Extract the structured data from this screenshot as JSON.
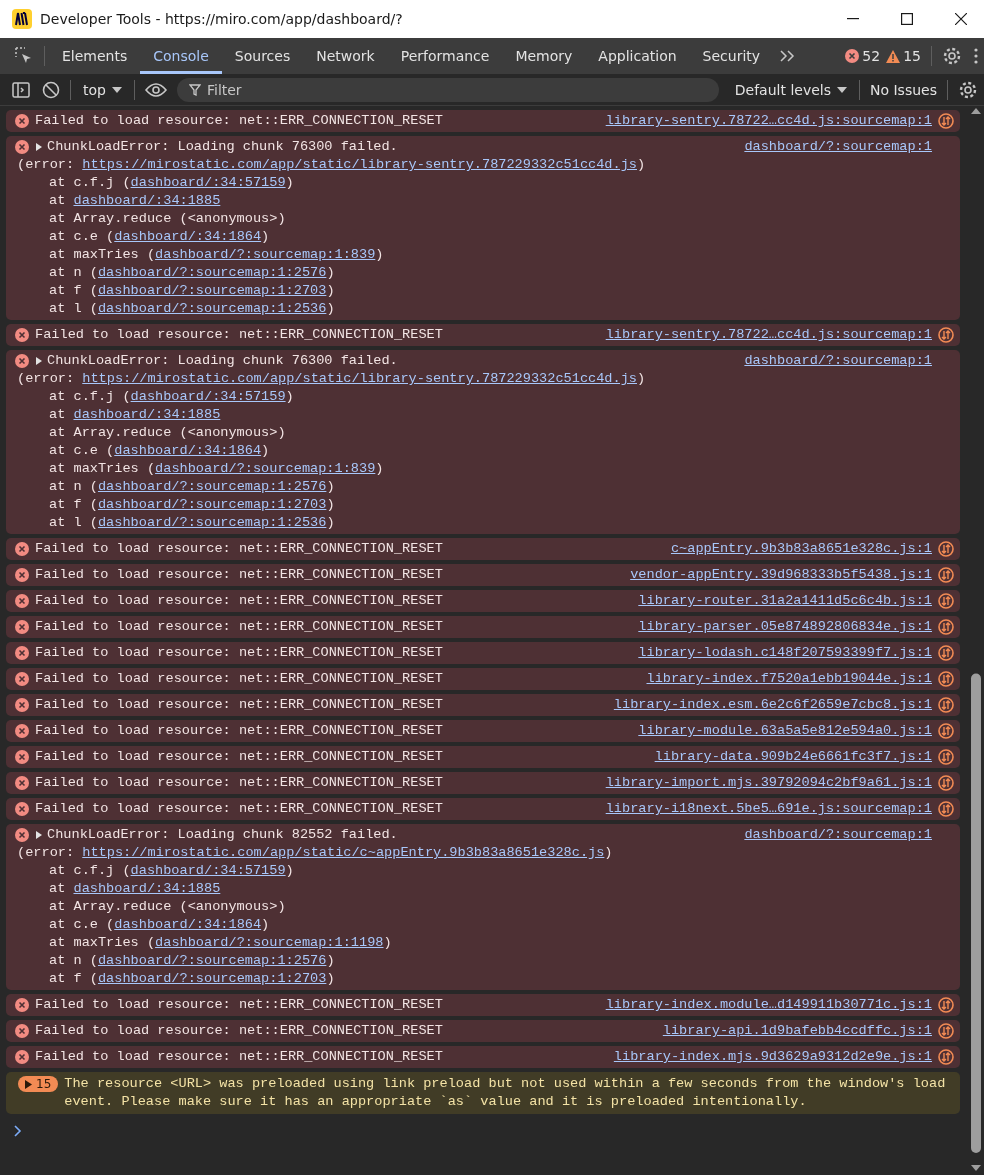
{
  "window": {
    "title": "Developer Tools - https://miro.com/app/dashboard/?"
  },
  "tabs": [
    {
      "label": "Elements",
      "selected": false
    },
    {
      "label": "Console",
      "selected": true
    },
    {
      "label": "Sources",
      "selected": false
    },
    {
      "label": "Network",
      "selected": false
    },
    {
      "label": "Performance",
      "selected": false
    },
    {
      "label": "Memory",
      "selected": false
    },
    {
      "label": "Application",
      "selected": false
    },
    {
      "label": "Security",
      "selected": false
    }
  ],
  "counts": {
    "errors": "52",
    "warnings": "15"
  },
  "toolbar": {
    "context": "top",
    "filter_placeholder": "Filter",
    "levels": "Default levels",
    "issues": "No Issues"
  },
  "messages": [
    {
      "kind": "resource",
      "text": "Failed to load resource: net::ERR_CONNECTION_RESET",
      "source": "library-sentry.78722…cc4d.js:sourcemap:1"
    },
    {
      "kind": "chunk",
      "text": "ChunkLoadError: Loading chunk 76300 failed.",
      "source": "dashboard/?:sourcemap:1",
      "lines": [
        {
          "kind": "error",
          "before": "(error: ",
          "link": "https://mirostatic.com/app/static/library-sentry.787229332c51cc4d.js",
          "after": ")"
        },
        {
          "kind": "frame",
          "before": "at c.f.j (",
          "link": "dashboard/:34:57159",
          "after": ")"
        },
        {
          "kind": "frame",
          "before": "at ",
          "link": "dashboard/:34:1885"
        },
        {
          "kind": "frame",
          "before": "at Array.reduce (<anonymous>)"
        },
        {
          "kind": "frame",
          "before": "at c.e (",
          "link": "dashboard/:34:1864",
          "after": ")"
        },
        {
          "kind": "frame",
          "before": "at maxTries (",
          "link": "dashboard/?:sourcemap:1:839",
          "after": ")"
        },
        {
          "kind": "frame",
          "before": "at n (",
          "link": "dashboard/?:sourcemap:1:2576",
          "after": ")"
        },
        {
          "kind": "frame",
          "before": "at f (",
          "link": "dashboard/?:sourcemap:1:2703",
          "after": ")"
        },
        {
          "kind": "frame",
          "before": "at l (",
          "link": "dashboard/?:sourcemap:1:2536",
          "after": ")"
        }
      ]
    },
    {
      "kind": "resource",
      "text": "Failed to load resource: net::ERR_CONNECTION_RESET",
      "source": "library-sentry.78722…cc4d.js:sourcemap:1"
    },
    {
      "kind": "chunk",
      "text": "ChunkLoadError: Loading chunk 76300 failed.",
      "source": "dashboard/?:sourcemap:1",
      "lines": [
        {
          "kind": "error",
          "before": "(error: ",
          "link": "https://mirostatic.com/app/static/library-sentry.787229332c51cc4d.js",
          "after": ")"
        },
        {
          "kind": "frame",
          "before": "at c.f.j (",
          "link": "dashboard/:34:57159",
          "after": ")"
        },
        {
          "kind": "frame",
          "before": "at ",
          "link": "dashboard/:34:1885"
        },
        {
          "kind": "frame",
          "before": "at Array.reduce (<anonymous>)"
        },
        {
          "kind": "frame",
          "before": "at c.e (",
          "link": "dashboard/:34:1864",
          "after": ")"
        },
        {
          "kind": "frame",
          "before": "at maxTries (",
          "link": "dashboard/?:sourcemap:1:839",
          "after": ")"
        },
        {
          "kind": "frame",
          "before": "at n (",
          "link": "dashboard/?:sourcemap:1:2576",
          "after": ")"
        },
        {
          "kind": "frame",
          "before": "at f (",
          "link": "dashboard/?:sourcemap:1:2703",
          "after": ")"
        },
        {
          "kind": "frame",
          "before": "at l (",
          "link": "dashboard/?:sourcemap:1:2536",
          "after": ")"
        }
      ]
    },
    {
      "kind": "resource",
      "text": "Failed to load resource: net::ERR_CONNECTION_RESET",
      "source": "c~appEntry.9b3b83a8651e328c.js:1"
    },
    {
      "kind": "resource",
      "text": "Failed to load resource: net::ERR_CONNECTION_RESET",
      "source": "vendor-appEntry.39d968333b5f5438.js:1"
    },
    {
      "kind": "resource",
      "text": "Failed to load resource: net::ERR_CONNECTION_RESET",
      "source": "library-router.31a2a1411d5c6c4b.js:1"
    },
    {
      "kind": "resource",
      "text": "Failed to load resource: net::ERR_CONNECTION_RESET",
      "source": "library-parser.05e874892806834e.js:1"
    },
    {
      "kind": "resource",
      "text": "Failed to load resource: net::ERR_CONNECTION_RESET",
      "source": "library-lodash.c148f207593399f7.js:1"
    },
    {
      "kind": "resource",
      "text": "Failed to load resource: net::ERR_CONNECTION_RESET",
      "source": "library-index.f7520a1ebb19044e.js:1"
    },
    {
      "kind": "resource",
      "text": "Failed to load resource: net::ERR_CONNECTION_RESET",
      "source": "library-index.esm.6e2c6f2659e7cbc8.js:1"
    },
    {
      "kind": "resource",
      "text": "Failed to load resource: net::ERR_CONNECTION_RESET",
      "source": "library-module.63a5a5e812e594a0.js:1"
    },
    {
      "kind": "resource",
      "text": "Failed to load resource: net::ERR_CONNECTION_RESET",
      "source": "library-data.909b24e6661fc3f7.js:1"
    },
    {
      "kind": "resource",
      "text": "Failed to load resource: net::ERR_CONNECTION_RESET",
      "source": "library-import.mjs.39792094c2bf9a61.js:1"
    },
    {
      "kind": "resource",
      "text": "Failed to load resource: net::ERR_CONNECTION_RESET",
      "source": "library-i18next.5be5…691e.js:sourcemap:1"
    },
    {
      "kind": "chunk",
      "text": "ChunkLoadError: Loading chunk 82552 failed.",
      "source": "dashboard/?:sourcemap:1",
      "lines": [
        {
          "kind": "error",
          "before": "(error: ",
          "link": "https://mirostatic.com/app/static/c~appEntry.9b3b83a8651e328c.js",
          "after": ")"
        },
        {
          "kind": "frame",
          "before": "at c.f.j (",
          "link": "dashboard/:34:57159",
          "after": ")"
        },
        {
          "kind": "frame",
          "before": "at ",
          "link": "dashboard/:34:1885"
        },
        {
          "kind": "frame",
          "before": "at Array.reduce (<anonymous>)"
        },
        {
          "kind": "frame",
          "before": "at c.e (",
          "link": "dashboard/:34:1864",
          "after": ")"
        },
        {
          "kind": "frame",
          "before": "at maxTries (",
          "link": "dashboard/?:sourcemap:1:1198",
          "after": ")"
        },
        {
          "kind": "frame",
          "before": "at n (",
          "link": "dashboard/?:sourcemap:1:2576",
          "after": ")"
        },
        {
          "kind": "frame",
          "before": "at f (",
          "link": "dashboard/?:sourcemap:1:2703",
          "after": ")"
        }
      ]
    },
    {
      "kind": "resource",
      "text": "Failed to load resource: net::ERR_CONNECTION_RESET",
      "source": "library-index.module…d149911b30771c.js:1"
    },
    {
      "kind": "resource",
      "text": "Failed to load resource: net::ERR_CONNECTION_RESET",
      "source": "library-api.1d9bafebb4ccdffc.js:1"
    },
    {
      "kind": "resource",
      "text": "Failed to load resource: net::ERR_CONNECTION_RESET",
      "source": "library-index.mjs.9d3629a9312d2e9e.js:1"
    },
    {
      "kind": "warning",
      "count": "15",
      "text": "The resource <URL> was preloaded using link preload but not used within a few seconds from the window's load event. Please make sure it has an appropriate `as` value and it is preloaded intentionally."
    }
  ]
}
